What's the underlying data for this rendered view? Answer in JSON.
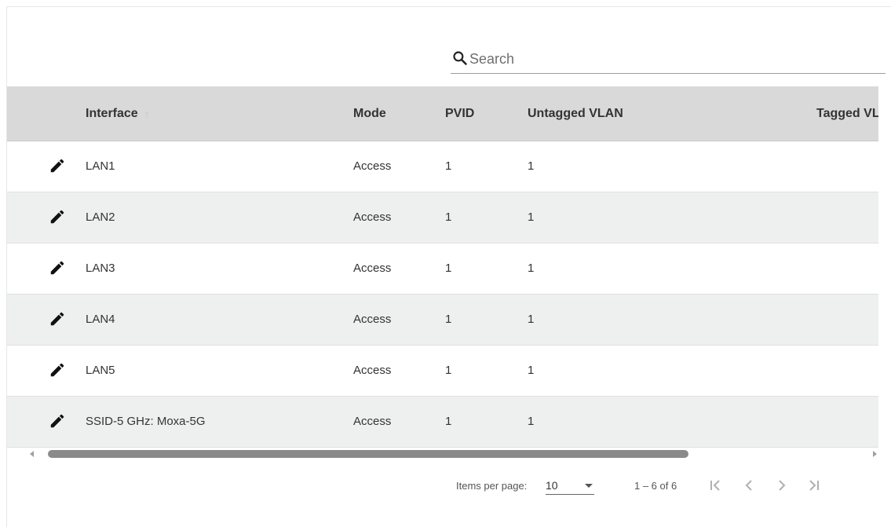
{
  "search": {
    "placeholder": "Search",
    "value": ""
  },
  "table": {
    "columns": [
      "Interface",
      "Mode",
      "PVID",
      "Untagged VLAN",
      "Tagged VL"
    ],
    "rows": [
      {
        "interface": "LAN1",
        "mode": "Access",
        "pvid": "1",
        "untagged": "1",
        "tagged": ""
      },
      {
        "interface": "LAN2",
        "mode": "Access",
        "pvid": "1",
        "untagged": "1",
        "tagged": ""
      },
      {
        "interface": "LAN3",
        "mode": "Access",
        "pvid": "1",
        "untagged": "1",
        "tagged": ""
      },
      {
        "interface": "LAN4",
        "mode": "Access",
        "pvid": "1",
        "untagged": "1",
        "tagged": ""
      },
      {
        "interface": "LAN5",
        "mode": "Access",
        "pvid": "1",
        "untagged": "1",
        "tagged": ""
      },
      {
        "interface": "SSID-5 GHz: Moxa-5G",
        "mode": "Access",
        "pvid": "1",
        "untagged": "1",
        "tagged": ""
      }
    ]
  },
  "paginator": {
    "items_per_page_label": "Items per page:",
    "items_per_page_value": "10",
    "range_label": "1 – 6 of 6"
  },
  "icons": {
    "search": "search-icon",
    "edit": "pencil-icon",
    "sort": "arrow-up-icon",
    "first": "first-page-icon",
    "prev": "chevron-left-icon",
    "next": "chevron-right-icon",
    "last": "last-page-icon"
  },
  "colors": {
    "header_bg": "#d9d9d9",
    "alt_row_bg": "#eef0ef",
    "scroll_thumb": "#8a8a8a"
  }
}
